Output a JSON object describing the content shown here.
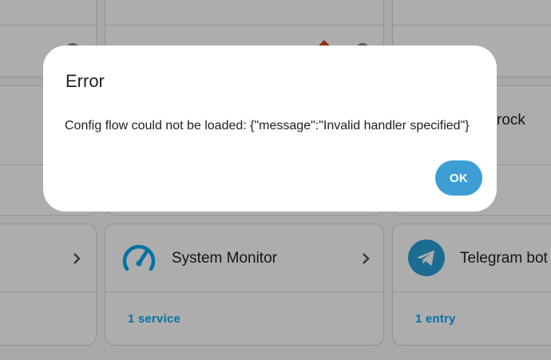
{
  "dialog": {
    "title": "Error",
    "message": "Config flow could not be loaded: {\"message\":\"Invalid handler specified\"}",
    "ok_label": "OK"
  },
  "cards": {
    "partial_mid_right": {
      "title_fragment": "rock"
    },
    "system_monitor": {
      "title": "System Monitor",
      "link": "1 service",
      "icon": "speedometer-icon"
    },
    "telegram_bot": {
      "title": "Telegram bot",
      "link": "1 entry",
      "icon": "telegram-icon"
    }
  },
  "colors": {
    "accent": "#03a9f4",
    "ok_button": "#3d9ed6",
    "telegram": "#2a9fd8",
    "scrim": "rgba(0,0,0,0.32)"
  }
}
